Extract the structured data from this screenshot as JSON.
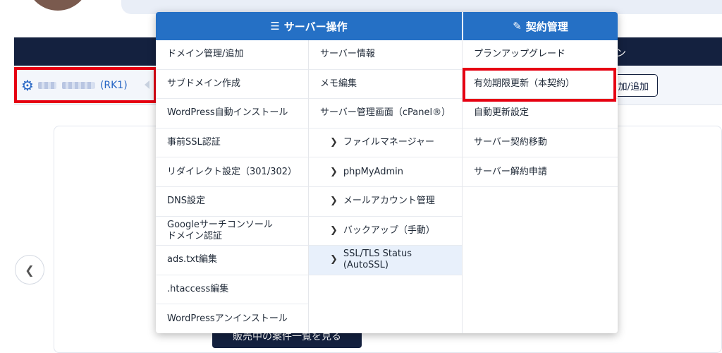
{
  "background": {
    "navy_bar_text": "ン",
    "server": {
      "label_suffix": "(RK1)"
    },
    "add_button_label": "加/追加",
    "cta_label": "販売中の案件一覧を見る",
    "prev_icon": "chevron-left-icon"
  },
  "menu": {
    "headers": {
      "server_ops": "サーバー操作",
      "contract": "契約管理"
    },
    "column1": [
      "ドメイン管理/追加",
      "サブドメイン作成",
      "WordPress自動インストール",
      "事前SSL認証",
      "リダイレクト設定（301/302）",
      "DNS設定",
      "Googleサーチコンソール ドメイン認証",
      "ads.txt編集",
      ".htaccess編集",
      "WordPressアンインストール"
    ],
    "column2": [
      "サーバー情報",
      "メモ編集",
      "サーバー管理画面（cPanel®）",
      "ファイルマネージャー",
      "phpMyAdmin",
      "メールアカウント管理",
      "バックアップ（手動）",
      "SSL/TLS Status (AutoSSL)"
    ],
    "column3": [
      "プランアップグレード",
      "有効期限更新（本契約）",
      "自動更新設定",
      "サーバー契約移動",
      "サーバー解約申請"
    ]
  },
  "colors": {
    "menu_header": "#2570c5",
    "navy": "#14213f",
    "highlight_border": "#e60012",
    "link_blue": "#2565c4"
  }
}
